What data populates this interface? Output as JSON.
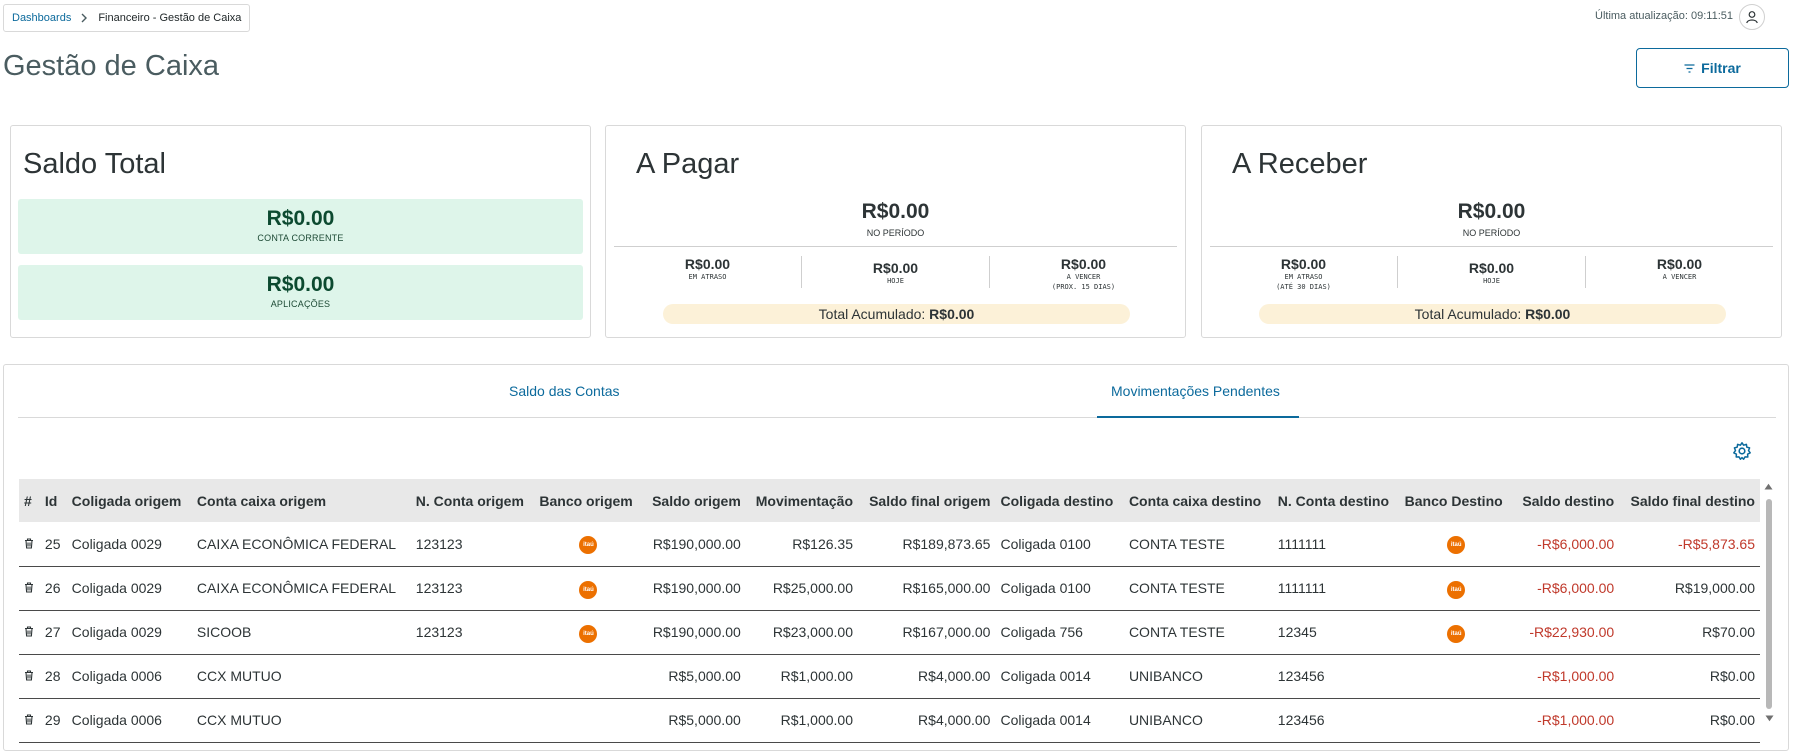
{
  "breadcrumb": {
    "root": "Dashboards",
    "current": "Financeiro - Gestão de Caixa"
  },
  "header": {
    "last_update": "Última atualização: 09:11:51",
    "title": "Gestão de Caixa",
    "filter_label": "Filtrar"
  },
  "saldo_total": {
    "title": "Saldo Total",
    "conta_corrente_value": "R$0.00",
    "conta_corrente_label": "CONTA CORRENTE",
    "aplicacoes_value": "R$0.00",
    "aplicacoes_label": "APLICAÇÕES"
  },
  "a_pagar": {
    "title": "A Pagar",
    "main_value": "R$0.00",
    "main_label": "NO PERÍODO",
    "atraso_value": "R$0.00",
    "atraso_label": "EM ATRASO",
    "hoje_value": "R$0.00",
    "hoje_label": "HOJE",
    "vencer_value": "R$0.00",
    "vencer_label_1": "A VENCER",
    "vencer_label_2": "(PROX. 15 DIAS)",
    "acc_label": "Total Acumulado:",
    "acc_value": "R$0.00"
  },
  "a_receber": {
    "title": "A Receber",
    "main_value": "R$0.00",
    "main_label": "NO PERÍODO",
    "atraso_value": "R$0.00",
    "atraso_label_1": "EM ATRASO",
    "atraso_label_2": "(ATÉ 30 DIAS)",
    "hoje_value": "R$0.00",
    "hoje_label": "HOJE",
    "vencer_value": "R$0.00",
    "vencer_label": "A VENCER",
    "acc_label": "Total Acumulado:",
    "acc_value": "R$0.00"
  },
  "tabs": {
    "tab1": "Saldo das Contas",
    "tab2": "Movimentações Pendentes"
  },
  "table": {
    "headers": [
      "#",
      "Id",
      "Coligada origem",
      "Conta caixa origem",
      "N. Conta origem",
      "Banco origem",
      "Saldo origem",
      "Movimentação",
      "Saldo final origem",
      "Coligada destino",
      "Conta caixa destino",
      "N. Conta destino",
      "Banco Destino",
      "Saldo destino",
      "Saldo final destino"
    ],
    "bank_logo_text": "itaú",
    "rows": [
      {
        "id": "25",
        "coligada_origem": "Coligada 0029",
        "conta_origem": "CAIXA ECONÔMICA FEDERAL",
        "n_conta_origem": "123123",
        "saldo_origem": "R$190,000.00",
        "movimentacao": "R$126.35",
        "saldo_final_origem": "R$189,873.65",
        "coligada_destino": "Coligada 0100",
        "conta_destino": "CONTA TESTE",
        "n_conta_destino": "1111111",
        "saldo_destino": "-R$6,000.00",
        "saldo_final_destino": "-R$5,873.65"
      },
      {
        "id": "26",
        "coligada_origem": "Coligada 0029",
        "conta_origem": "CAIXA ECONÔMICA FEDERAL",
        "n_conta_origem": "123123",
        "saldo_origem": "R$190,000.00",
        "movimentacao": "R$25,000.00",
        "saldo_final_origem": "R$165,000.00",
        "coligada_destino": "Coligada 0100",
        "conta_destino": "CONTA TESTE",
        "n_conta_destino": "1111111",
        "saldo_destino": "-R$6,000.00",
        "saldo_final_destino": "R$19,000.00"
      },
      {
        "id": "27",
        "coligada_origem": "Coligada 0029",
        "conta_origem": "SICOOB",
        "n_conta_origem": "123123",
        "saldo_origem": "R$190,000.00",
        "movimentacao": "R$23,000.00",
        "saldo_final_origem": "R$167,000.00",
        "coligada_destino": "Coligada 756",
        "conta_destino": "CONTA TESTE",
        "n_conta_destino": "12345",
        "saldo_destino": "-R$22,930.00",
        "saldo_final_destino": "R$70.00"
      },
      {
        "id": "28",
        "coligada_origem": "Coligada 0006",
        "conta_origem": "CCX MUTUO",
        "n_conta_origem": "",
        "saldo_origem": "R$5,000.00",
        "movimentacao": "R$1,000.00",
        "saldo_final_origem": "R$4,000.00",
        "coligada_destino": "Coligada 0014",
        "conta_destino": "UNIBANCO",
        "n_conta_destino": "123456",
        "saldo_destino": "-R$1,000.00",
        "saldo_final_destino": "R$0.00"
      },
      {
        "id": "29",
        "coligada_origem": "Coligada 0006",
        "conta_origem": "CCX MUTUO",
        "n_conta_origem": "",
        "saldo_origem": "R$5,000.00",
        "movimentacao": "R$1,000.00",
        "saldo_final_origem": "R$4,000.00",
        "coligada_destino": "Coligada 0014",
        "conta_destino": "UNIBANCO",
        "n_conta_destino": "123456",
        "saldo_destino": "-R$1,000.00",
        "saldo_final_destino": "R$0.00"
      }
    ]
  },
  "colors": {
    "accent": "#0c6a9c",
    "negative": "#c0392b",
    "saldo_bg": "#def5ea",
    "accumulated_bg": "#fcf1d8",
    "itau": "#ec7000"
  }
}
